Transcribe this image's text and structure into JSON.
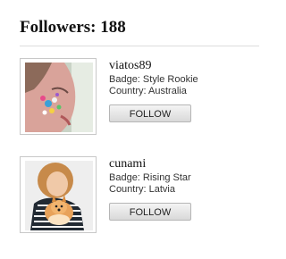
{
  "header": {
    "title": "Followers: 188"
  },
  "followers": [
    {
      "username": "viatos89",
      "badge": "Badge: Style Rookie",
      "country": "Country: Australia",
      "follow_label": "FOLLOW",
      "avatar": "profile-photo-face-glitter"
    },
    {
      "username": "cunami",
      "badge": "Badge: Rising Star",
      "country": "Country: Latvia",
      "follow_label": "FOLLOW",
      "avatar": "profile-photo-woman-with-dog"
    }
  ],
  "colors": {
    "text": "#333333",
    "heading": "#111111",
    "divider": "#dddddd",
    "button": "#e6e6e6"
  }
}
